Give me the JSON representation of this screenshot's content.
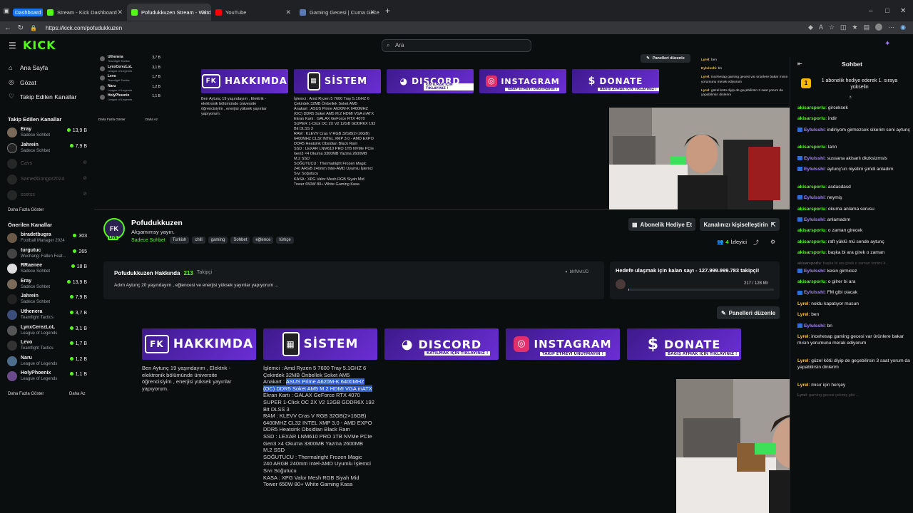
{
  "browser": {
    "tabs": [
      {
        "label": "Dashboard",
        "active": false
      },
      {
        "label": "Stream - Kick Dashboard",
        "active": false
      },
      {
        "label": "Pofudukkuzen Stream - Watch Li...",
        "active": true
      },
      {
        "label": "YouTube",
        "active": false
      },
      {
        "label": "Gaming Gecesi | Cuma Gecesi 22...",
        "active": false
      }
    ],
    "url": "https://kick.com/pofudukkuzen",
    "colors": {
      "kick_green": "#53fc18",
      "youtube_red": "#ff0000"
    }
  },
  "header": {
    "logo": "KICK",
    "search_placeholder": "Ara"
  },
  "sidebar": {
    "nav": [
      {
        "label": "Ana Sayfa",
        "icon": "home-icon"
      },
      {
        "label": "Gözat",
        "icon": "compass-icon"
      },
      {
        "label": "Takip Edilen Kanallar",
        "icon": "heart-icon"
      }
    ],
    "followed_title": "Takip Edilen Kanallar",
    "followed": [
      {
        "name": "Eray",
        "category": "Sadece Sohbet",
        "viewers": "13,9 B",
        "online": true
      },
      {
        "name": "Jahrein",
        "category": "Sadece Sohbet",
        "viewers": "7,9 B",
        "online": true
      },
      {
        "name": "Cavs",
        "category": "",
        "viewers": "",
        "online": false
      },
      {
        "name": "SamedGongor2024",
        "category": "",
        "viewers": "",
        "online": false
      },
      {
        "name": "ssetss",
        "category": "",
        "viewers": "",
        "online": false
      }
    ],
    "show_more": "Daha Fazla Göster",
    "recommended_title": "Önerilen Kanallar",
    "recommended": [
      {
        "name": "biradetbugra",
        "category": "Football Manager 2024",
        "viewers": "303"
      },
      {
        "name": "turgutuc",
        "category": "Wuchang: Fallen Feat...",
        "viewers": "265"
      },
      {
        "name": "RRaenee",
        "category": "Sadece Sohbet",
        "viewers": "18 B"
      },
      {
        "name": "Eray",
        "category": "Sadece Sohbet",
        "viewers": "13,9 B"
      },
      {
        "name": "Jahrein",
        "category": "Sadece Sohbet",
        "viewers": "7,9 B"
      },
      {
        "name": "Uthenera",
        "category": "Teamfight Tactics",
        "viewers": "3,7 B"
      },
      {
        "name": "LynxCerezLoL",
        "category": "League of Legends",
        "viewers": "3,1 B"
      },
      {
        "name": "Levo",
        "category": "Teamfight Tactics",
        "viewers": "1,7 B"
      },
      {
        "name": "Naru",
        "category": "League of Legends",
        "viewers": "1,2 B"
      },
      {
        "name": "HolyPhoenix",
        "category": "League of Legends",
        "viewers": "1,1 B"
      }
    ],
    "show_more_2": "Daha Fazla Göster",
    "show_less": "Daha Az"
  },
  "embed": {
    "mini_channels": [
      {
        "name": "Uthenera",
        "category": "Teamfight Tactics",
        "viewers": "3,7 B"
      },
      {
        "name": "LynxCerezLoL",
        "category": "League of Legends",
        "viewers": "3,1 B"
      },
      {
        "name": "Levo",
        "category": "Teamfight Tactics",
        "viewers": "1,7 B"
      },
      {
        "name": "Naru",
        "category": "League of Legends",
        "viewers": "1,2 B"
      },
      {
        "name": "HolyPhoenix",
        "category": "League of Legends",
        "viewers": "1,1 B"
      }
    ],
    "mini_more": "Daha Fazla Göster",
    "mini_less": "Daha Az",
    "edit_panels": "Panelleri düzenle"
  },
  "channel": {
    "name": "Pofudukkuzen",
    "title": "Akşamımsy yayın.",
    "category": "Sadece Sohbet",
    "tags": [
      "Turkish",
      "chill",
      "gaming",
      "Sohbet",
      "eğlence",
      "türkçe"
    ],
    "live_badge": "LIVE",
    "gift_sub_button": "Abonelik Hediye Et",
    "customize_button": "Kanalınızı kişiselleştirin",
    "viewers_count": "4",
    "viewers_label": "İzleyici"
  },
  "about": {
    "title": "Pofudukkuzen Hakkında",
    "followers": "213",
    "followers_label": "Takipçi",
    "bio": "Adım Aytunç 20 yaşındayım , eğlencesi ve enerjisi yüksek yayınlar yapıyorum ...",
    "discord_id": "bhfMvtUD"
  },
  "goal": {
    "title": "Hedefe ulaşmak için kalan sayı - 127.999.999.783 takipçi!",
    "progress_text": "217 / 128 Mr",
    "progress_fraction": 1.7e-06
  },
  "panels": {
    "edit_button": "Panelleri düzenle",
    "items": [
      {
        "title": "HAKKIMDA",
        "subtitle": "",
        "icon": "fk-logo-icon"
      },
      {
        "title": "SİSTEM",
        "subtitle": "",
        "icon": "pc-case-icon"
      },
      {
        "title": "DISCORD",
        "subtitle": "KATILMAK İÇİN TIKLAYINIZ !",
        "icon": "discord-icon"
      },
      {
        "title": "INSTAGRAM",
        "subtitle": "TAKİP ETMEYİ UNUTMAYIN !",
        "icon": "instagram-icon"
      },
      {
        "title": "DONATE",
        "subtitle": "BAĞIŞ ATMAK İÇİN TIKLAYINIZ !",
        "icon": "money-bag-icon"
      }
    ],
    "about_text": [
      "Ben Aytunç 19 yaşındayım , Elektrik -",
      "elektronik bölümünde üniversite",
      "öğrencisiyim , enerjisi yüksek yayınlar",
      "yapıyorum."
    ],
    "system_text_before": [
      "İşlemci : Amd Ryzen 5 7600 Tray 5.1GHZ 6",
      "Çekirdek 32MB Önbellek Soket AM5"
    ],
    "system_text_prefix": "Anakart : ",
    "system_text_selected_1": "ASUS Prime A620M-K 6400MHZ",
    "system_text_selected_2": "(OC) DDR5 Soket AM5 M.2 HDMI VGA mATX",
    "system_text_after": [
      "Ekran Kartı : GALAX GeForce RTX 4070",
      "SUPER 1-Click OC 2X V2 12GB GDDR6X 192",
      "Bit DLSS 3",
      "RAM : KLEVV Cras V RGB 32GB(2×16GB)",
      "6400MHZ CL32 INTEL XMP 3.0 - AMD EXPO",
      "DDR5 Heatsink Obsidian Black Ram",
      "SSD : LEXAR LNM610 PRO 1TB NVMe PCIe",
      "Gen3 ×4 Okuma 3300MB Yazma 2600MB",
      "M.2 SSD",
      "SOĞUTUCU : Thermalright Frozen Magic",
      "240 ARGB 240mm Intel-AMD Uyumlu İşlemci",
      "Sıvı Soğutucu",
      "KASA : XPG Valor Mesh RGB Siyah Mid",
      "Tower 650W 80+ White Gaming Kasa"
    ],
    "mini_system_text": [
      "İşlemci : Amd Ryzen 5 7600 Tray 5.1GHZ 6",
      "Çekirdek 32MB Önbellek Soket AM5",
      "Anakart : ASUS Prime A620M-K 6400MHZ",
      "(OC) DDR5 Soket AM5 M.2 HDMI VGA mATX",
      "Ekran Kartı : GALAX GeForce RTX 4070",
      "SUPER 1-Click OC 2X V2 12GB GDDR6X 192",
      "Bit DLSS 3",
      "RAM : KLEVV Cras V RGB 32GB(2×16GB)",
      "6400MHZ CL32 INTEL XMP 3.0 - AMD EXPO",
      "DDR5 Heatsink Obsidian Black Ram",
      "SSD : LEXAR LNM610 PRO 1TB NVMe PCIe",
      "Gen3 ×4 Okuma 3300MB Yazma 2600MB",
      "M.2 SSD",
      "SOĞUTUCU : Thermalright Frozen Magic",
      "240 ARGB 240mm Intel-AMD Uyumlu İşlemci",
      "Sıvı Soğutucu",
      "KASA : XPG Valor Mesh RGB Siyah Mid",
      "Tower 650W 80+ White Gaming Kasa"
    ]
  },
  "chat": {
    "title": "Sohbet",
    "pinned": "1 abonelik hediye ederek 1. sıraya yükselin",
    "pinned_rank": "1",
    "mini_messages": [
      {
        "user": "Lyrel",
        "text": "ben"
      },
      {
        "user": "Eylulsshi",
        "text": "bn"
      },
      {
        "user": "Lyrel",
        "text": "incehesap gaming gecesi var ürünlere bakar mısın yorumunu merak ediyorum"
      },
      {
        "user": "Lyrel",
        "text": "güzel kötü diyip de geçebilirsin 3 saat yorum da yapabilirsin dinlerim"
      }
    ],
    "messages": [
      {
        "user": "akisarsporlu",
        "text": "girceksek",
        "color": "green"
      },
      {
        "user": "akisarsporlu",
        "text": "indir",
        "color": "green"
      },
      {
        "user": "Eylulsshi",
        "text": "indiriyom girmezsek sikerim seni aytunç",
        "color": "purple"
      },
      {
        "user": "akisarsporlu",
        "text": "lann",
        "color": "green"
      },
      {
        "user": "Eylulsshi",
        "text": "sussana akisarlı dkzksizmsls",
        "color": "purple"
      },
      {
        "user": "Eylulsshi",
        "text": "aytunç'un niyetini şimdi anladım",
        "color": "purple"
      },
      {
        "user": "akisarsporlu",
        "text": "asdasdasd",
        "color": "green"
      },
      {
        "user": "Eylulsshi",
        "text": "neymiş",
        "color": "purple"
      },
      {
        "user": "akisarsporlu",
        "text": "okuma anlama sorusu",
        "color": "green"
      },
      {
        "user": "Eylulsshi",
        "text": "anlamadım",
        "color": "purple"
      },
      {
        "user": "akisarsporlu",
        "text": "o zaman girecek",
        "color": "green"
      },
      {
        "user": "akisarsporlu",
        "text": "raft yüklü mü sende aytunç",
        "color": "green"
      },
      {
        "user": "akisarsporlu",
        "text": "başka bi ara girek o zaman",
        "color": "green"
      },
      {
        "user": "akisarsporlu",
        "text": "başka bi ara girek o zaman ismimi k...",
        "color": "faded"
      },
      {
        "user": "Eylulsshi",
        "text": "kesin girmicez",
        "color": "purple"
      },
      {
        "user": "akisarsporlu",
        "text": "o gilrer bi ara",
        "color": "green"
      },
      {
        "user": "Eylulsshi",
        "text": "FM gibi olacak",
        "color": "purple"
      },
      {
        "user": "Lyrel",
        "text": "noldu kapatıyor musun",
        "color": "yellow"
      },
      {
        "user": "Lyrel",
        "text": "ben",
        "color": "yellow"
      },
      {
        "user": "Eylulsshi",
        "text": "bn",
        "color": "purple"
      },
      {
        "user": "Lyrel",
        "text": "incehesap gaming gecesi var ürünlere bakar mısın yorumunu merak ediyorum",
        "color": "yellow"
      },
      {
        "user": "Lyrel",
        "text": "güzel kötü diyip de geçebilirsin 3 saat yorum da yapabilirsin dinlerim",
        "color": "yellow"
      },
      {
        "user": "Lyrel",
        "text": "mısır için herşey",
        "color": "yellow"
      },
      {
        "user": "Lyrel",
        "text": "gaming gecesi çekmiş gibi ...",
        "color": "faded"
      }
    ]
  }
}
